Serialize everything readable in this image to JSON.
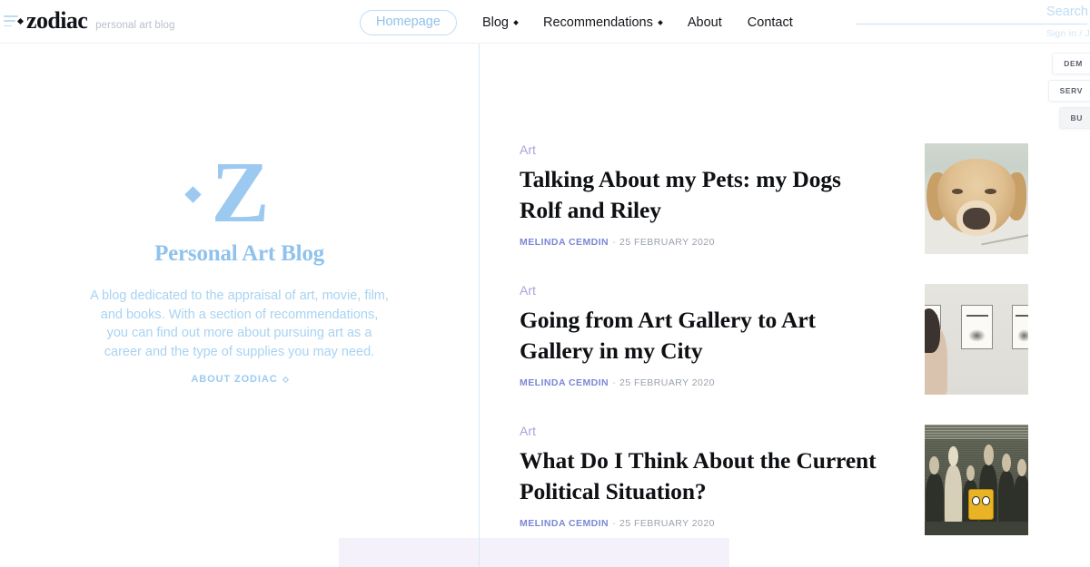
{
  "header": {
    "menu_icon": "hamburger-icon",
    "brand_name": "zodiac",
    "brand_tagline": "personal art blog",
    "nav": [
      {
        "label": "Homepage",
        "active": true,
        "has_caret": false
      },
      {
        "label": "Blog",
        "active": false,
        "has_caret": true
      },
      {
        "label": "Recommendations",
        "active": false,
        "has_caret": true
      },
      {
        "label": "About",
        "active": false,
        "has_caret": false
      },
      {
        "label": "Contact",
        "active": false,
        "has_caret": false
      }
    ],
    "search_label": "Search",
    "search_placeholder": "Search",
    "search_value": "",
    "signin_label": "Sign in / J"
  },
  "side_tabs": [
    {
      "label": "DEM"
    },
    {
      "label": "SERV"
    },
    {
      "label": "BU"
    }
  ],
  "hero": {
    "logo_letter": "Z",
    "title": "Personal Art Blog",
    "description": "A blog dedicated to the appraisal of art, movie, film, and books. With a section of recommendations, you can find out more about pursuing art as a career and the type of supplies you may need.",
    "cta_label": "ABOUT ZODIAC"
  },
  "feed": {
    "posts": [
      {
        "category": "Art",
        "title": "Talking About my Pets: my Dogs Rolf and Riley",
        "author": "MELINDA CEMDIN",
        "separator": "-",
        "date": "25 FEBRUARY 2020",
        "thumbnail": "golden-retriever-photo"
      },
      {
        "category": "Art",
        "title": "Going from Art Gallery to Art Gallery in my City",
        "author": "MELINDA CEMDIN",
        "separator": "-",
        "date": "25 FEBRUARY 2020",
        "thumbnail": "art-gallery-wall-photo"
      },
      {
        "category": "Art",
        "title": "What Do I Think About the Current Political Situation?",
        "author": "MELINDA CEMDIN",
        "separator": "-",
        "date": "25 FEBRUARY 2020",
        "thumbnail": "vintage-political-photo"
      }
    ]
  },
  "colors": {
    "accent_blue": "#9cc9f0",
    "accent_light_blue": "#a8d3f2",
    "category_purple": "#a8a3dd",
    "author_purple": "#7b87d6",
    "text_dark": "#0e1014",
    "muted_gray": "#9aa1ad",
    "divider": "#d8e8f4",
    "bottom_panel": "#f4f1fa"
  }
}
